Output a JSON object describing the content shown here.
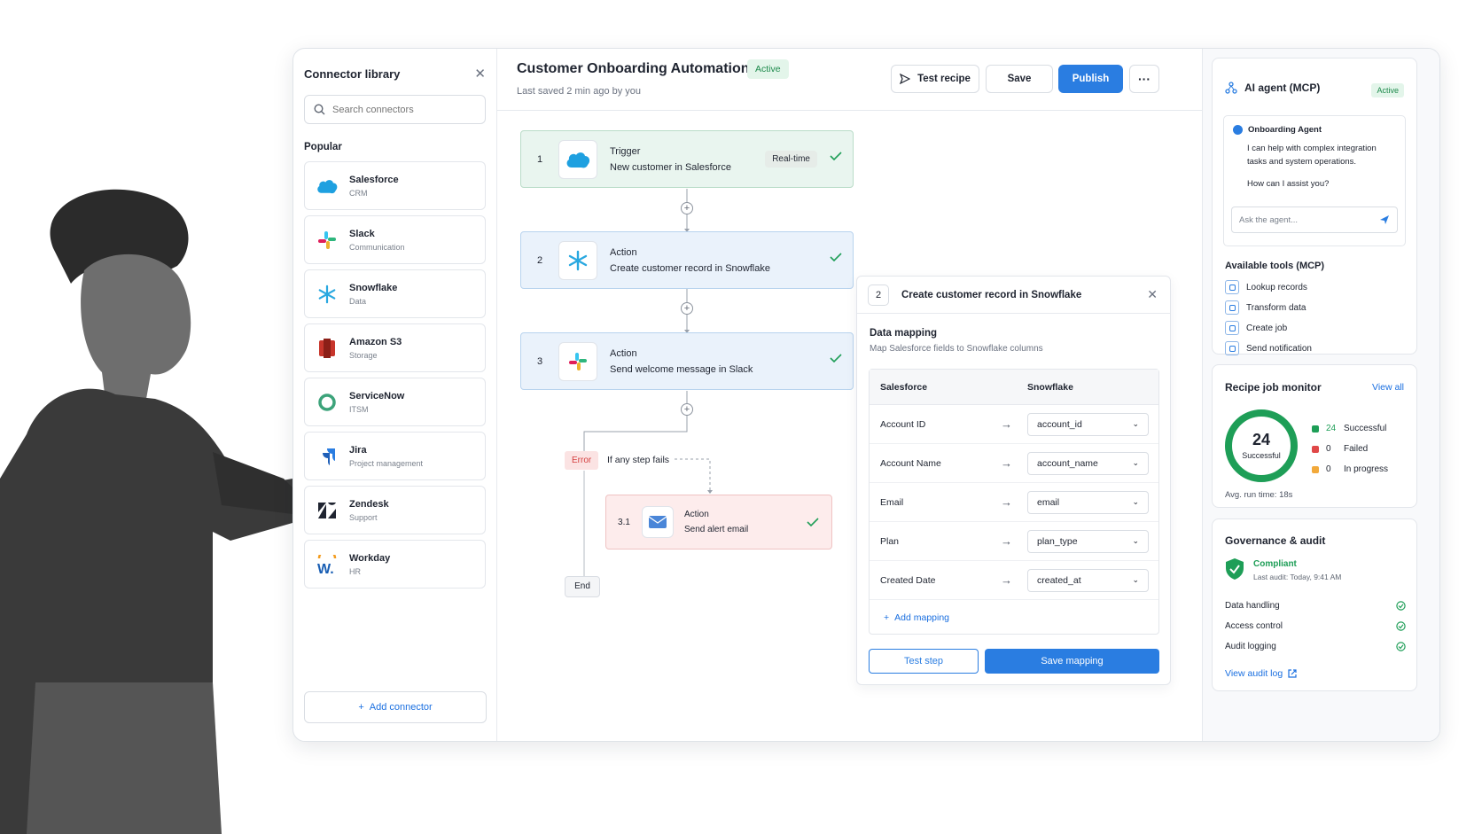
{
  "library": {
    "title": "Connector library",
    "search_placeholder": "Search connectors",
    "section_label": "Popular",
    "connectors": [
      {
        "name": "Salesforce",
        "category": "CRM",
        "icon": "salesforce-icon"
      },
      {
        "name": "Slack",
        "category": "Communication",
        "icon": "slack-icon"
      },
      {
        "name": "Snowflake",
        "category": "Data",
        "icon": "snowflake-icon"
      },
      {
        "name": "Amazon S3",
        "category": "Storage",
        "icon": "amazon-s3-icon"
      },
      {
        "name": "ServiceNow",
        "category": "ITSM",
        "icon": "servicenow-icon"
      },
      {
        "name": "Jira",
        "category": "Project management",
        "icon": "jira-icon"
      },
      {
        "name": "Zendesk",
        "category": "Support",
        "icon": "zendesk-icon"
      },
      {
        "name": "Workday",
        "category": "HR",
        "icon": "workday-icon"
      }
    ],
    "add_label": "Add connector"
  },
  "header": {
    "title": "Customer Onboarding Automation",
    "status": "Active",
    "last_saved": "Last saved 2 min ago by you",
    "test_label": "Test recipe",
    "save_label": "Save",
    "publish_label": "Publish"
  },
  "flow": {
    "steps": [
      {
        "num": "1",
        "kind": "Trigger",
        "desc": "New customer in Salesforce",
        "tag": "Real-time"
      },
      {
        "num": "2",
        "kind": "Action",
        "desc": "Create customer record in Snowflake"
      },
      {
        "num": "3",
        "kind": "Action",
        "desc": "Send welcome message in Slack"
      }
    ],
    "error_label": "Error",
    "error_text": "If any step fails",
    "alert_step": {
      "num": "3.1",
      "kind": "Action",
      "desc": "Send alert email"
    },
    "end_label": "End"
  },
  "detail": {
    "step_num": "2",
    "title": "Create customer record in Snowflake",
    "section_title": "Data mapping",
    "section_sub": "Map Salesforce fields to Snowflake columns",
    "col_source": "Salesforce",
    "col_target": "Snowflake",
    "rows": [
      {
        "source": "Account ID",
        "target": "account_id"
      },
      {
        "source": "Account Name",
        "target": "account_name"
      },
      {
        "source": "Email",
        "target": "email"
      },
      {
        "source": "Plan",
        "target": "plan_type"
      },
      {
        "source": "Created Date",
        "target": "created_at"
      }
    ],
    "add_mapping": "Add mapping",
    "test_step": "Test step",
    "save_mapping": "Save mapping"
  },
  "agent": {
    "title": "AI agent (MCP)",
    "status": "Active",
    "agent_name": "Onboarding Agent",
    "message": "I can help with complex integration tasks and system operations.",
    "question": "How can I assist you?",
    "input_placeholder": "Ask the agent...",
    "tools_title": "Available tools (MCP)",
    "tools": [
      "Lookup records",
      "Transform data",
      "Create job",
      "Send notification"
    ]
  },
  "monitor": {
    "title": "Recipe job monitor",
    "view_all": "View all",
    "center_value": "24",
    "center_label": "Successful",
    "stats": [
      {
        "value": "24",
        "label": "Successful",
        "color": "#1e9e57"
      },
      {
        "value": "0",
        "label": "Failed",
        "color": "#e04848"
      },
      {
        "value": "0",
        "label": "In progress",
        "color": "#f2a93b"
      }
    ],
    "avg_runtime": "Avg. run time: 18s"
  },
  "governance": {
    "title": "Governance & audit",
    "status": "Compliant",
    "last_audit": "Last audit: Today, 9:41 AM",
    "checks": [
      "Data handling",
      "Access control",
      "Audit logging"
    ],
    "view_log": "View audit log"
  },
  "colors": {
    "accent": "#2a7de1",
    "success": "#1e9e57",
    "error": "#e04848"
  }
}
